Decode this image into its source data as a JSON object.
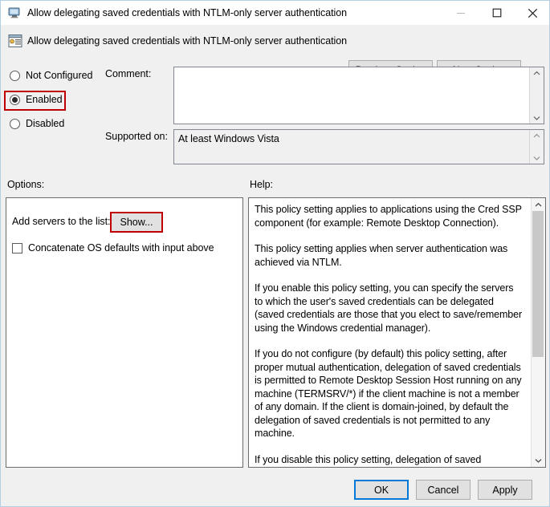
{
  "window": {
    "title": "Allow delegating saved credentials with NTLM-only server authentication",
    "icon": "computer-policy-icon",
    "controls": {
      "minimize": "minimize-icon",
      "maximize": "maximize-icon",
      "close": "close-icon"
    }
  },
  "header": {
    "icon": "policy-setting-icon",
    "title": "Allow delegating saved credentials with NTLM-only server authentication",
    "previous_setting_label": "Previous Setting",
    "next_setting_label": "Next Setting"
  },
  "state": {
    "options": [
      {
        "label": "Not Configured",
        "selected": false
      },
      {
        "label": "Enabled",
        "selected": true
      },
      {
        "label": "Disabled",
        "selected": false
      }
    ],
    "selected_state": "Enabled"
  },
  "comment": {
    "label": "Comment:",
    "value": "",
    "scroll_up_icon": "chevron-up-icon",
    "scroll_down_icon": "chevron-down-icon"
  },
  "supported_on": {
    "label": "Supported on:",
    "value": "At least Windows Vista",
    "scroll_up_icon": "chevron-up-icon",
    "scroll_down_icon": "chevron-down-icon"
  },
  "options_panel": {
    "label": "Options:",
    "add_servers_label": "Add servers to the list:",
    "show_button_label": "Show...",
    "concatenate_label": "Concatenate OS defaults with input above",
    "concatenate_checked": false
  },
  "help_panel": {
    "label": "Help:",
    "paragraphs": [
      "This policy setting applies to applications using the Cred SSP component (for example: Remote Desktop Connection).",
      "This policy setting applies when server authentication was achieved via NTLM.",
      "If you enable this policy setting, you can specify the servers to which the user's saved credentials can be delegated (saved credentials are those that you elect to save/remember using the Windows credential manager).",
      "If you do not configure (by default) this policy setting, after proper mutual authentication, delegation of saved credentials is permitted to Remote Desktop Session Host running on any machine (TERMSRV/*) if the client machine is not a member of any domain. If the client is domain-joined, by default the delegation of saved credentials is not permitted to any machine.",
      "If you disable this policy setting, delegation of saved credentials is not permitted to any machine."
    ],
    "scroll_up_icon": "chevron-up-icon",
    "scroll_down_icon": "chevron-down-icon"
  },
  "footer": {
    "ok_label": "OK",
    "cancel_label": "Cancel",
    "apply_label": "Apply"
  },
  "annotations": {
    "highlight_color": "#c00000",
    "highlighted_elements": [
      "Enabled",
      "Show..."
    ]
  }
}
